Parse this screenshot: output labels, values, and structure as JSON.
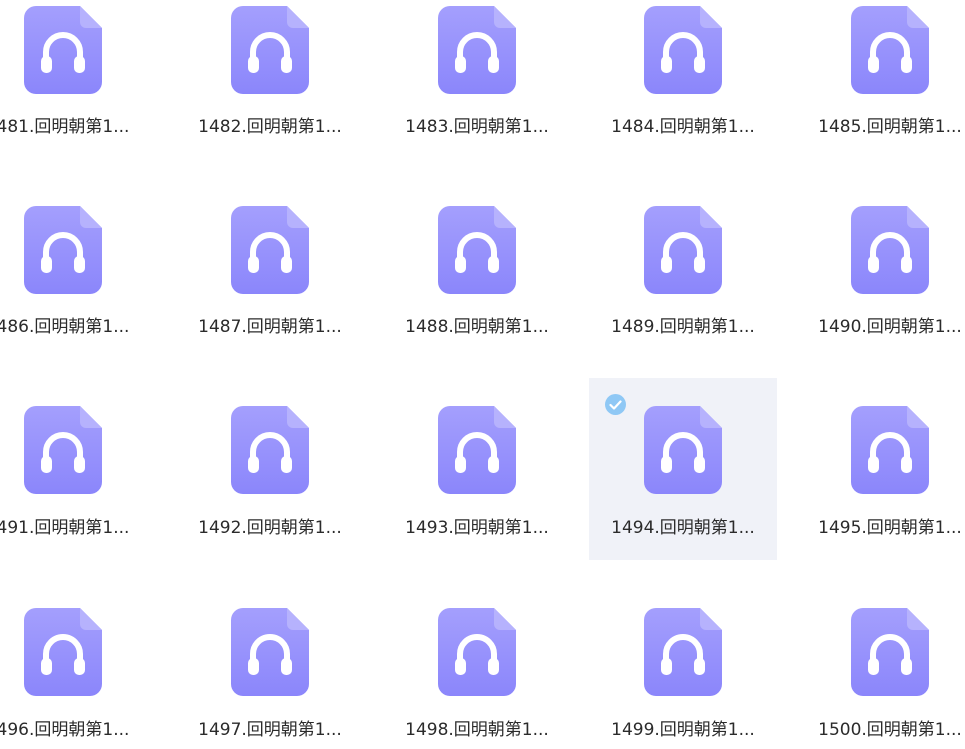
{
  "files": [
    {
      "label": "481.回明朝第1...",
      "selected": false
    },
    {
      "label": "1482.回明朝第1...",
      "selected": false
    },
    {
      "label": "1483.回明朝第1...",
      "selected": false
    },
    {
      "label": "1484.回明朝第1...",
      "selected": false
    },
    {
      "label": "1485.回明朝第1...",
      "selected": false
    },
    {
      "label": "486.回明朝第1...",
      "selected": false
    },
    {
      "label": "1487.回明朝第1...",
      "selected": false
    },
    {
      "label": "1488.回明朝第1...",
      "selected": false
    },
    {
      "label": "1489.回明朝第1...",
      "selected": false
    },
    {
      "label": "1490.回明朝第1...",
      "selected": false
    },
    {
      "label": "491.回明朝第1...",
      "selected": false
    },
    {
      "label": "1492.回明朝第1...",
      "selected": false
    },
    {
      "label": "1493.回明朝第1...",
      "selected": false
    },
    {
      "label": "1494.回明朝第1...",
      "selected": true
    },
    {
      "label": "1495.回明朝第1...",
      "selected": false
    },
    {
      "label": "496.回明朝第1...",
      "selected": false
    },
    {
      "label": "1497.回明朝第1...",
      "selected": false
    },
    {
      "label": "1498.回明朝第1...",
      "selected": false
    },
    {
      "label": "1499.回明朝第1...",
      "selected": false
    },
    {
      "label": "1500.回明朝第1...",
      "selected": false
    }
  ],
  "icon": "headphones-audio-file-icon",
  "colors": {
    "icon_fill": "#8b86fb",
    "icon_fill_light": "#a49ffd",
    "icon_fold": "#b6b2fd",
    "headphone": "#ffffff",
    "selected_bg": "#f0f2f8",
    "check_badge": "#8fc8f5",
    "label_text": "#2b2b2b"
  }
}
